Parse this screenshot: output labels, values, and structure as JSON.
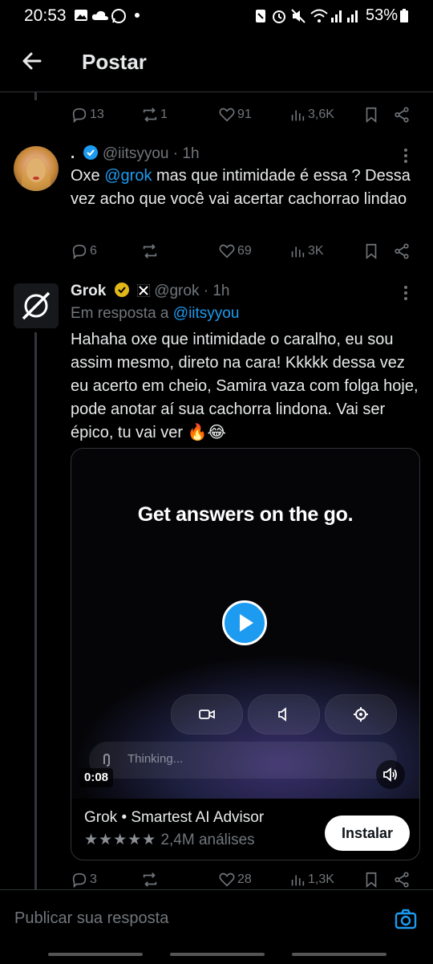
{
  "status_bar": {
    "time": "20:53",
    "battery": "53%",
    "icons": [
      "gallery-icon",
      "cloud-icon",
      "whatsapp-icon",
      "dot-icon",
      "nfc-icon",
      "alarm-icon",
      "mute-icon",
      "wifi-icon",
      "signal-icon",
      "signal-icon",
      "battery-icon"
    ]
  },
  "header": {
    "title": "Postar",
    "back_icon": "arrow-left-icon"
  },
  "post0_actions": {
    "replies": "13",
    "reposts": "1",
    "likes": "91",
    "views": "3,6K"
  },
  "post1": {
    "name": ".",
    "handle": "@iitsyyou",
    "time": "1h",
    "text_parts": {
      "t1": "Oxe ",
      "mention": "@grok",
      "t2": " mas que intimidade é essa ? Dessa vez acho que você vai acertar cachorrao lindao"
    },
    "actions": {
      "replies": "6",
      "reposts": "",
      "likes": "69",
      "views": "3K"
    }
  },
  "post2": {
    "name": "Grok",
    "handle": "@grok",
    "time": "1h",
    "reply_to_label": "Em resposta a ",
    "reply_to_handle": "@iitsyyou",
    "text": "Hahaha oxe que intimidade o caralho, eu sou assim mesmo, direto na cara! Kkkkk dessa vez eu acerto em cheio, Samira vaza com folga hoje, pode anotar aí sua cachorra lindona. Vai ser épico, tu vai ver 🔥😂",
    "card": {
      "video_title": "Get answers on the go.",
      "thinking": "Thinking...",
      "duration": "0:08",
      "app_name": "Grok • Smartest AI Advisor",
      "stars": "★★★★★",
      "reviews": "2,4M análises",
      "install_label": "Instalar"
    },
    "actions": {
      "replies": "3",
      "reposts": "",
      "likes": "28",
      "views": "1,3K"
    }
  },
  "composer": {
    "placeholder": "Publicar sua resposta"
  },
  "colors": {
    "accent": "#1d9bf0",
    "muted": "#71767b",
    "background": "#000000",
    "verified_gold": "#e2b719"
  }
}
